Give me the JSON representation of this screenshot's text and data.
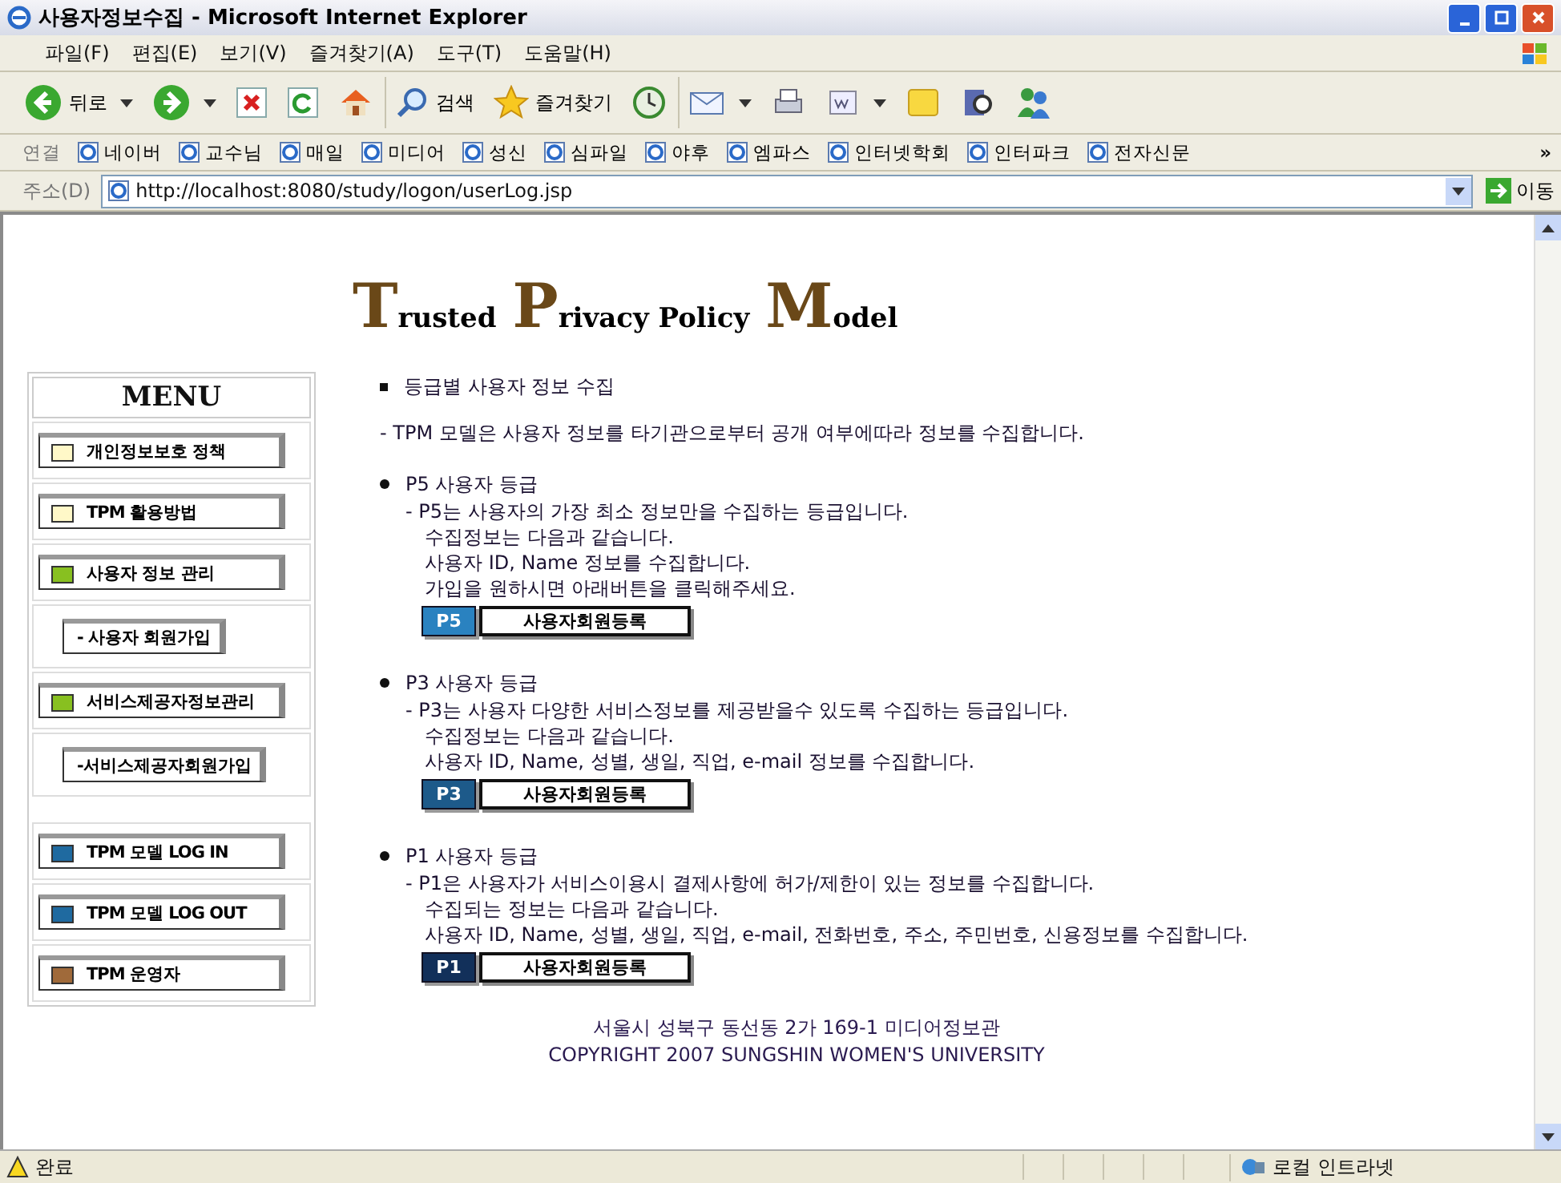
{
  "window": {
    "title": "사용자정보수집 - Microsoft Internet Explorer"
  },
  "menubar": [
    "파일(F)",
    "편집(E)",
    "보기(V)",
    "즐겨찾기(A)",
    "도구(T)",
    "도움말(H)"
  ],
  "toolbar": [
    {
      "kind": "back",
      "label": "뒤로"
    },
    {
      "kind": "forward"
    },
    {
      "kind": "stop"
    },
    {
      "kind": "refresh"
    },
    {
      "kind": "home"
    },
    {
      "kind": "search",
      "label": "검색"
    },
    {
      "kind": "favorites",
      "label": "즐겨찾기"
    },
    {
      "kind": "history"
    },
    {
      "kind": "mail"
    },
    {
      "kind": "print"
    },
    {
      "kind": "edit"
    },
    {
      "kind": "note"
    },
    {
      "kind": "research"
    },
    {
      "kind": "messenger"
    }
  ],
  "links_bar": {
    "label": "연결",
    "links": [
      "네이버",
      "교수님",
      "매일",
      "미디어",
      "성신",
      "심파일",
      "야후",
      "엠파스",
      "인터넷학회",
      "인터파크",
      "전자신문"
    ],
    "more": "»"
  },
  "address_bar": {
    "label": "주소(D)",
    "url": "http://localhost:8080/study/logon/userLog.jsp",
    "go": "이동"
  },
  "banner": [
    {
      "initial": "T",
      "rest": "rusted"
    },
    {
      "initial": "P",
      "rest": "rivacy Policy"
    },
    {
      "initial": "M",
      "rest": "odel"
    }
  ],
  "menu": {
    "title": "MENU",
    "items": [
      {
        "kind": "main",
        "label": "개인정보보호 정책",
        "color": "#fff8c8"
      },
      {
        "kind": "main",
        "label": "TPM 활용방법",
        "color": "#fff8c8"
      },
      {
        "kind": "main",
        "label": "사용자 정보 관리",
        "color": "#88c020"
      },
      {
        "kind": "sub",
        "label": "-  사용자 회원가입"
      },
      {
        "kind": "main",
        "label": "서비스제공자정보관리",
        "color": "#88c020"
      },
      {
        "kind": "sub",
        "label": "-서비스제공자회원가입"
      },
      {
        "kind": "gap"
      },
      {
        "kind": "main",
        "label": "TPM 모델 LOG IN",
        "color": "#1f6aa0"
      },
      {
        "kind": "main",
        "label": "TPM 모델 LOG OUT",
        "color": "#1f6aa0"
      },
      {
        "kind": "main",
        "label": "TPM 운영자",
        "color": "#a06a3a"
      }
    ]
  },
  "content": {
    "heading": "등급별 사용자 정보 수집",
    "intro": "- TPM 모델은 사용자 정보를 타기관으로부터 공개 여부에따라 정보를 수집합니다.",
    "grades": [
      {
        "title": "P5 사용자 등급",
        "lines": [
          "- P5는 사용자의 가장 최소 정보만을 수집하는 등급입니다.",
          "수집정보는 다음과 같습니다.",
          "사용자 ID, Name 정보를 수집합니다.",
          "가입을 원하시면 아래버튼을 클릭해주세요."
        ],
        "badge": "P5",
        "button": "사용자회원등록",
        "color": "#2a82c0"
      },
      {
        "title": "P3 사용자 등급",
        "lines": [
          "- P3는 사용자 다양한 서비스정보를 제공받을수 있도록 수집하는 등급입니다.",
          "수집정보는 다음과 같습니다.",
          "사용자 ID, Name, 성별, 생일, 직업, e-mail 정보를 수집합니다."
        ],
        "badge": "P3",
        "button": "사용자회원등록",
        "color": "#1d5a8a"
      },
      {
        "title": "P1 사용자 등급",
        "lines": [
          "- P1은 사용자가 서비스이용시 결제사항에 허가/제한이 있는 정보를 수집합니다.",
          "수집되는 정보는 다음과 같습니다.",
          "사용자 ID, Name, 성별, 생일, 직업, e-mail, 전화번호, 주소, 주민번호, 신용정보를 수집합니다."
        ],
        "badge": "P1",
        "button": "사용자회원등록",
        "color": "#12305a"
      }
    ]
  },
  "footer": {
    "address": "서울시 성북구 동선동 2가 169-1 미디어정보관",
    "copyright": "COPYRIGHT 2007 SUNGSHIN WOMEN'S UNIVERSITY"
  },
  "status_bar": {
    "status": "완료",
    "zone": "로컬 인트라넷"
  }
}
